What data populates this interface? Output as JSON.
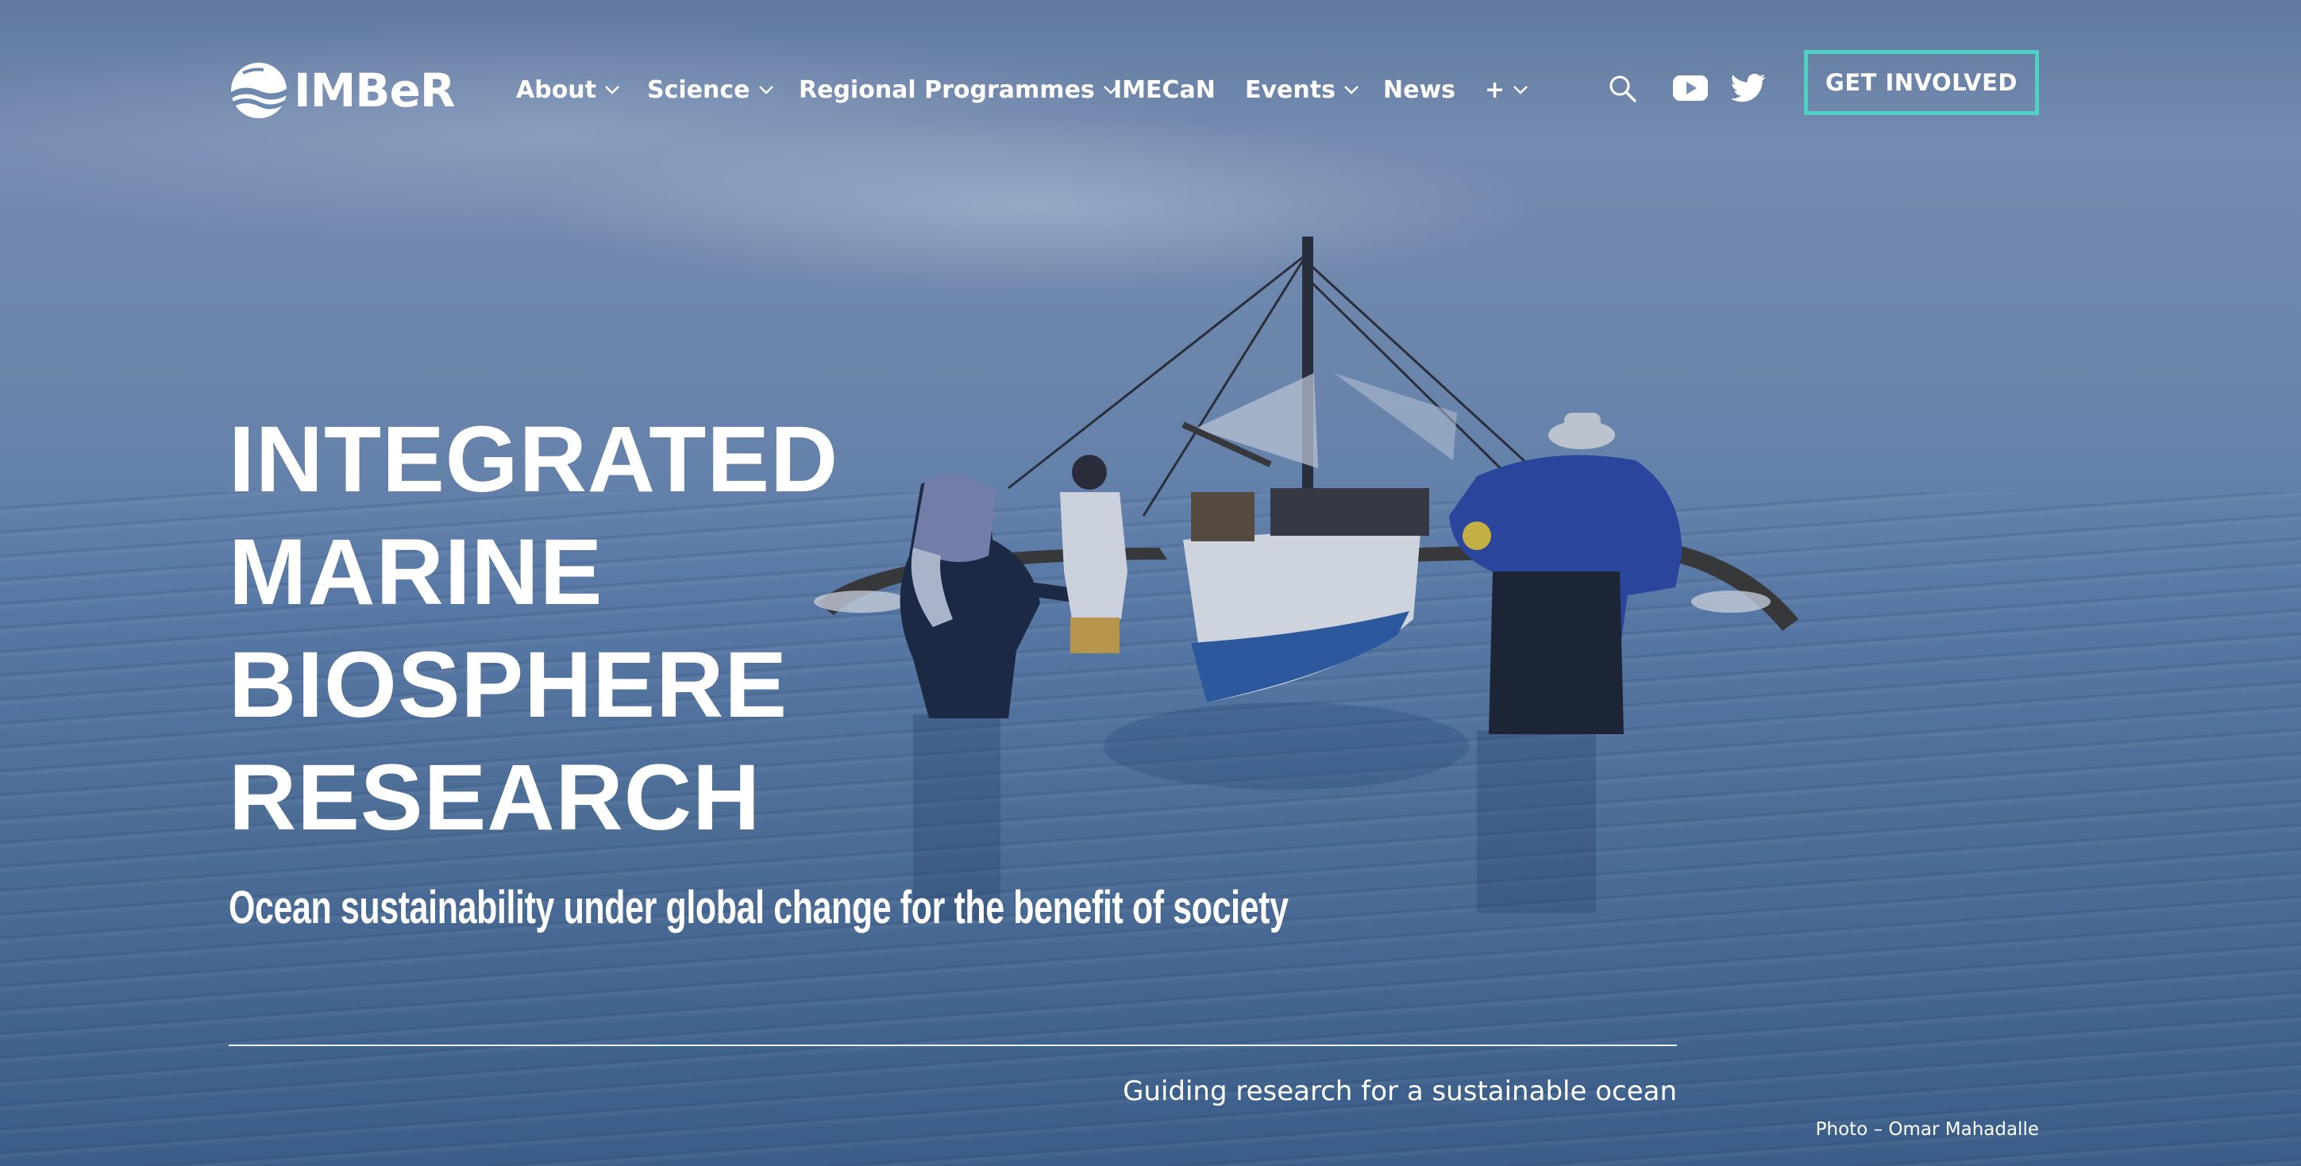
{
  "brand": {
    "name": "IMBeR",
    "accent_color": "#4fd1c5"
  },
  "nav": {
    "items": [
      {
        "label": "About",
        "has_dropdown": true
      },
      {
        "label": "Science",
        "has_dropdown": true
      },
      {
        "label": "Regional Programmes",
        "has_dropdown": true
      },
      {
        "label": "IMECaN",
        "has_dropdown": false
      },
      {
        "label": "Events",
        "has_dropdown": true
      },
      {
        "label": "News",
        "has_dropdown": false
      },
      {
        "label": "+",
        "has_dropdown": true
      }
    ],
    "icons": [
      "search-icon",
      "youtube-icon",
      "twitter-icon"
    ],
    "cta_label": "GET INVOLVED"
  },
  "hero": {
    "title_lines": [
      "INTEGRATED",
      "MARINE",
      "BIOSPHERE",
      "RESEARCH"
    ],
    "tagline": "Ocean sustainability under global change for the benefit of society",
    "subtext": "Guiding research for a sustainable ocean",
    "photo_credit": "Photo – Omar Mahadalle"
  }
}
